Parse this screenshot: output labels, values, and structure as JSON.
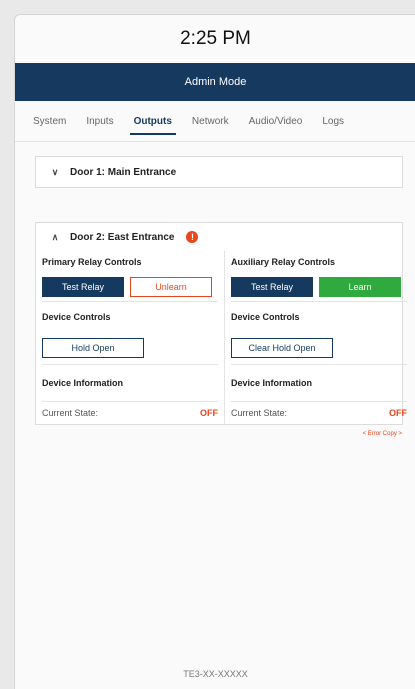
{
  "status_bar": {
    "time": "2:25 PM"
  },
  "mode_bar": {
    "label": "Admin Mode"
  },
  "tabs": [
    {
      "label": "System"
    },
    {
      "label": "Inputs"
    },
    {
      "label": "Outputs",
      "active": true
    },
    {
      "label": "Network"
    },
    {
      "label": "Audio/Video"
    },
    {
      "label": "Logs"
    }
  ],
  "door1": {
    "title": "Door 1: Main Entrance",
    "expanded": false
  },
  "door2": {
    "title": "Door 2: East Entrance",
    "expanded": true,
    "primary_relay": {
      "title": "Primary Relay Controls",
      "test_label": "Test Relay",
      "unlearn_label": "Unlearn"
    },
    "aux_relay": {
      "title": "Auxiliary Relay Controls",
      "test_label": "Test Relay",
      "learn_label": "Learn"
    },
    "device_controls_left": {
      "title": "Device Controls",
      "hold_open_label": "Hold Open"
    },
    "device_controls_right": {
      "title": "Device Controls",
      "clear_hold_open_label": "Clear Hold Open"
    },
    "device_info_left": {
      "title": "Device Information",
      "state_label": "Current State:",
      "state_value": "OFF"
    },
    "device_info_right": {
      "title": "Device Information",
      "state_label": "Current State:",
      "state_value": "OFF"
    }
  },
  "error_copy": "< Error Copy >",
  "footer": {
    "serial": "TE3-XX-XXXXX"
  },
  "colors": {
    "navy": "#163a5f",
    "orange": "#e8471c",
    "green": "#2eaa3f"
  }
}
